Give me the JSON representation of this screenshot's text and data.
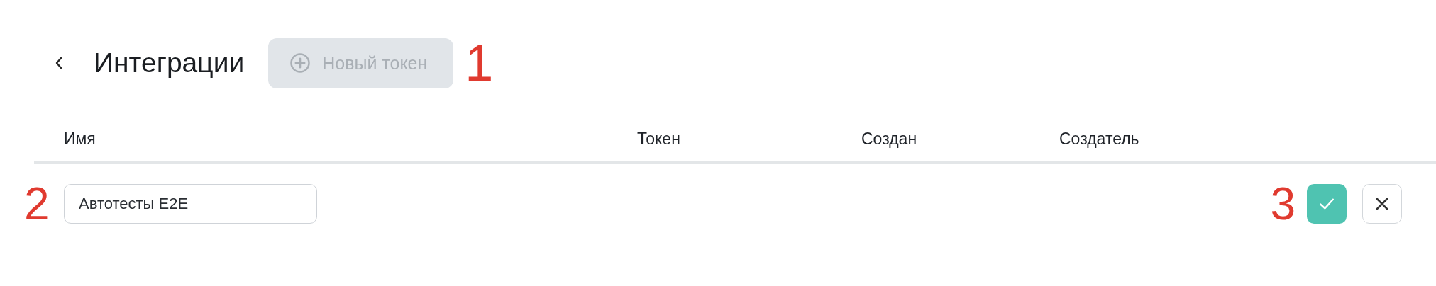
{
  "header": {
    "title": "Интеграции",
    "new_button": {
      "label": "Новый токен",
      "disabled": true
    },
    "marker": "1"
  },
  "table": {
    "columns": [
      "Имя",
      "Токен",
      "Создан",
      "Создатель"
    ],
    "edit_row": {
      "marker": "2",
      "name_value": "Автотесты E2E",
      "actions_marker": "3"
    }
  }
}
